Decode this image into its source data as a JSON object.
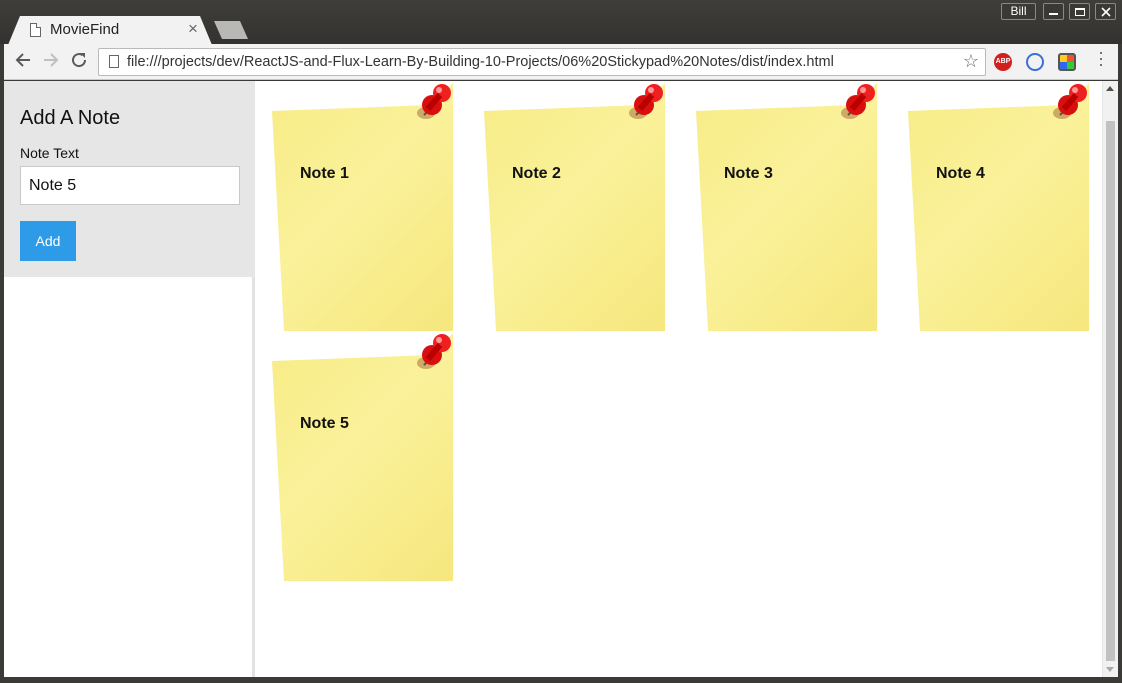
{
  "browser": {
    "tab_title": "MovieFind",
    "tab_close": "×",
    "url": "file:///projects/dev/ReactJS-and-Flux-Learn-By-Building-10-Projects/06%20Stickypad%20Notes/dist/index.html",
    "user": "Bill",
    "extensions": [
      "abp-icon",
      "sync-icon",
      "colorpicker-icon"
    ],
    "abp_label": "ABP"
  },
  "sidebar": {
    "heading": "Add A Note",
    "field_label": "Note Text",
    "input_value": "Note 5",
    "add_button": "Add"
  },
  "notes": [
    {
      "text": "Note 1"
    },
    {
      "text": "Note 2"
    },
    {
      "text": "Note 3"
    },
    {
      "text": "Note 4"
    },
    {
      "text": "Note 5"
    }
  ],
  "colors": {
    "note_yellow": "#f8ed8c",
    "pin_red": "#e01010",
    "add_button_blue": "#2d9be8",
    "sidebar_form_bg": "#e6e6e6"
  }
}
